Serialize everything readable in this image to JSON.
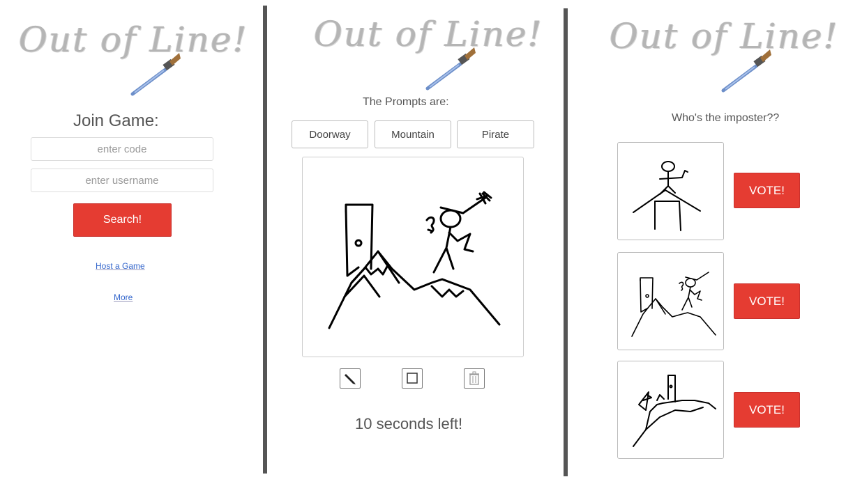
{
  "logo": {
    "text": "Out of Line!"
  },
  "join_screen": {
    "title": "Join Game:",
    "code_placeholder": "enter code",
    "username_placeholder": "enter username",
    "search_label": "Search!",
    "host_link": "Host a Game",
    "more_link": "More"
  },
  "draw_screen": {
    "prompt_heading": "The Prompts are:",
    "prompts": [
      "Doorway",
      "Mountain",
      "Pirate"
    ],
    "tools": [
      "pencil-icon",
      "square-icon",
      "trash-icon"
    ],
    "timer": "10 seconds left!"
  },
  "vote_screen": {
    "question": "Who's the imposter??",
    "vote_label": "VOTE!"
  },
  "colors": {
    "accent": "#e53c32",
    "divider": "#555555"
  }
}
